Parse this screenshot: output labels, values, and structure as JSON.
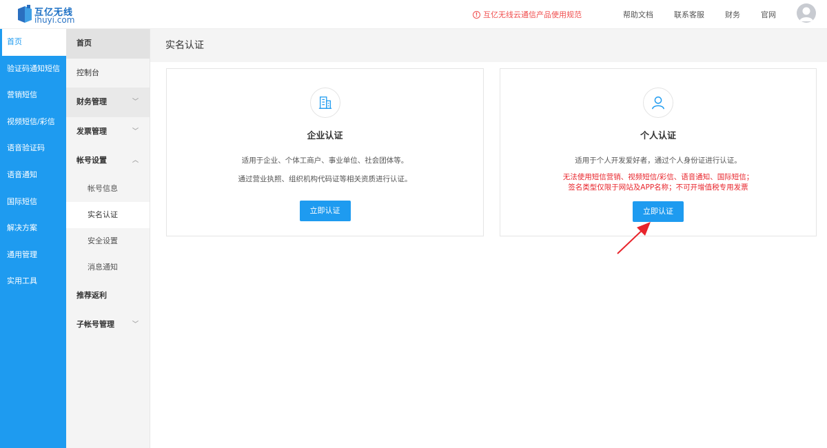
{
  "header": {
    "brand_cn": "互亿无线",
    "brand_en": "ihuyi.com",
    "notice": "互亿无线云通信产品使用规范",
    "links": [
      "帮助文档",
      "联系客服",
      "财务",
      "官网"
    ],
    "notice_color": "#f04d4d"
  },
  "sidebar_primary": {
    "accent": "#1e9bf0",
    "items": [
      "首页",
      "验证码通知短信",
      "营销短信",
      "视频短信/彩信",
      "语音验证码",
      "语音通知",
      "国际短信",
      "解决方案",
      "通用管理",
      "实用工具"
    ],
    "active": "首页"
  },
  "sidebar_secondary": {
    "home": "首页",
    "console": "控制台",
    "finance": "财务管理",
    "invoice": "发票管理",
    "account": "帐号设置",
    "account_sub": [
      "帐号信息",
      "实名认证",
      "安全设置",
      "消息通知"
    ],
    "referral": "推荐返利",
    "subaccount": "子帐号管理"
  },
  "main": {
    "page_title": "实名认证",
    "enterprise": {
      "title": "企业认证",
      "desc1": "适用于企业、个体工商户、事业单位、社会团体等。",
      "desc2": "通过营业执照、组织机构代码证等相关资质进行认证。",
      "button": "立即认证",
      "icon": "building-icon"
    },
    "personal": {
      "title": "个人认证",
      "desc1": "适用于个人开发爱好者，通过个人身份证进行认证。",
      "warning1": "无法使用短信营销、视频短信/彩信、语音通知、国际短信；",
      "warning2": "签名类型仅限于网站及APP名称；不可开增值税专用发票",
      "button": "立即认证",
      "icon": "user-icon"
    }
  }
}
